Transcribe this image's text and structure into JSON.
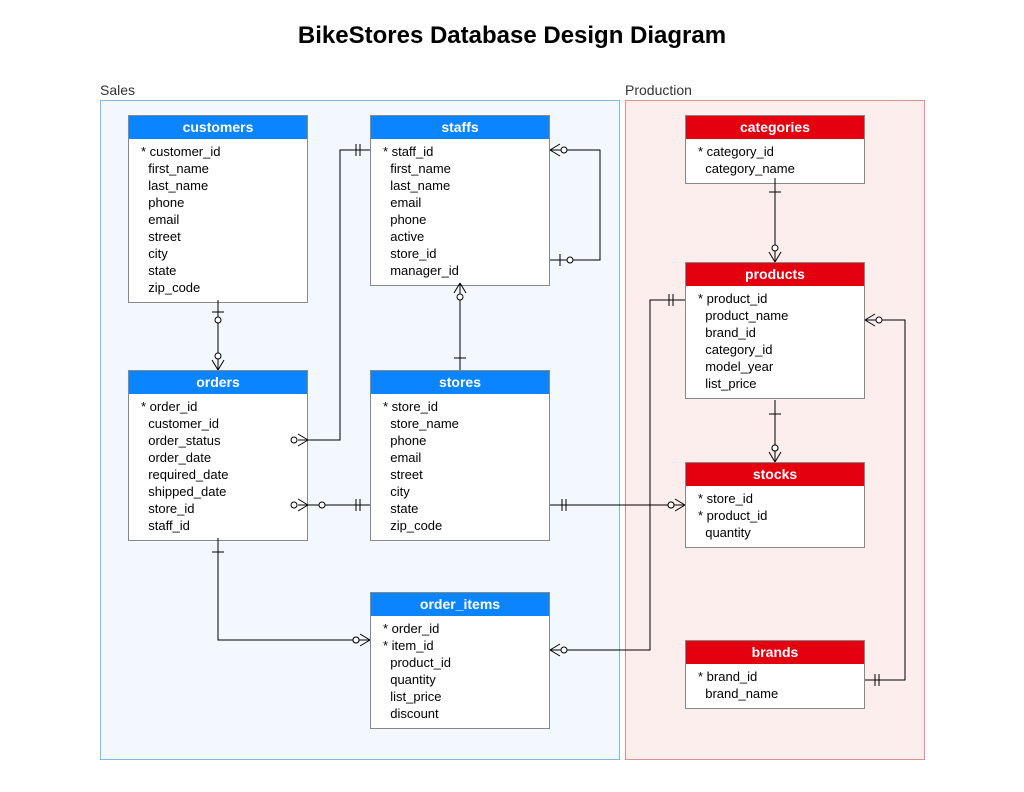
{
  "title": "BikeStores Database Design Diagram",
  "schemas": {
    "sales": {
      "label": "Sales"
    },
    "production": {
      "label": "Production"
    }
  },
  "tables": {
    "customers": {
      "title": "customers",
      "columns": [
        "* customer_id",
        "  first_name",
        "  last_name",
        "  phone",
        "  email",
        "  street",
        "  city",
        "  state",
        "  zip_code"
      ]
    },
    "staffs": {
      "title": "staffs",
      "columns": [
        "* staff_id",
        "  first_name",
        "  last_name",
        "  email",
        "  phone",
        "  active",
        "  store_id",
        "  manager_id"
      ]
    },
    "orders": {
      "title": "orders",
      "columns": [
        "* order_id",
        "  customer_id",
        "  order_status",
        "  order_date",
        "  required_date",
        "  shipped_date",
        "  store_id",
        "  staff_id"
      ]
    },
    "stores": {
      "title": "stores",
      "columns": [
        "* store_id",
        "  store_name",
        "  phone",
        "  email",
        "  street",
        "  city",
        "  state",
        "  zip_code"
      ]
    },
    "order_items": {
      "title": "order_items",
      "columns": [
        "* order_id",
        "* item_id",
        "  product_id",
        "  quantity",
        "  list_price",
        "  discount"
      ]
    },
    "categories": {
      "title": "categories",
      "columns": [
        "* category_id",
        "  category_name"
      ]
    },
    "products": {
      "title": "products",
      "columns": [
        "* product_id",
        "  product_name",
        "  brand_id",
        "  category_id",
        "  model_year",
        "  list_price"
      ]
    },
    "stocks": {
      "title": "stocks",
      "columns": [
        "* store_id",
        "* product_id",
        "  quantity"
      ]
    },
    "brands": {
      "title": "brands",
      "columns": [
        "* brand_id",
        "  brand_name"
      ]
    }
  },
  "relationships": [
    {
      "from": "customers",
      "to": "orders",
      "type": "1..*"
    },
    {
      "from": "staffs",
      "to": "orders",
      "type": "1..*"
    },
    {
      "from": "staffs",
      "to": "staffs",
      "type": "1..*",
      "self": true
    },
    {
      "from": "stores",
      "to": "staffs",
      "type": "1..*"
    },
    {
      "from": "stores",
      "to": "orders",
      "type": "1..*"
    },
    {
      "from": "orders",
      "to": "order_items",
      "type": "1..*"
    },
    {
      "from": "products",
      "to": "order_items",
      "type": "1..*"
    },
    {
      "from": "categories",
      "to": "products",
      "type": "1..*"
    },
    {
      "from": "brands",
      "to": "products",
      "type": "1..*"
    },
    {
      "from": "products",
      "to": "stocks",
      "type": "1..*"
    },
    {
      "from": "stores",
      "to": "stocks",
      "type": "1..*"
    }
  ]
}
